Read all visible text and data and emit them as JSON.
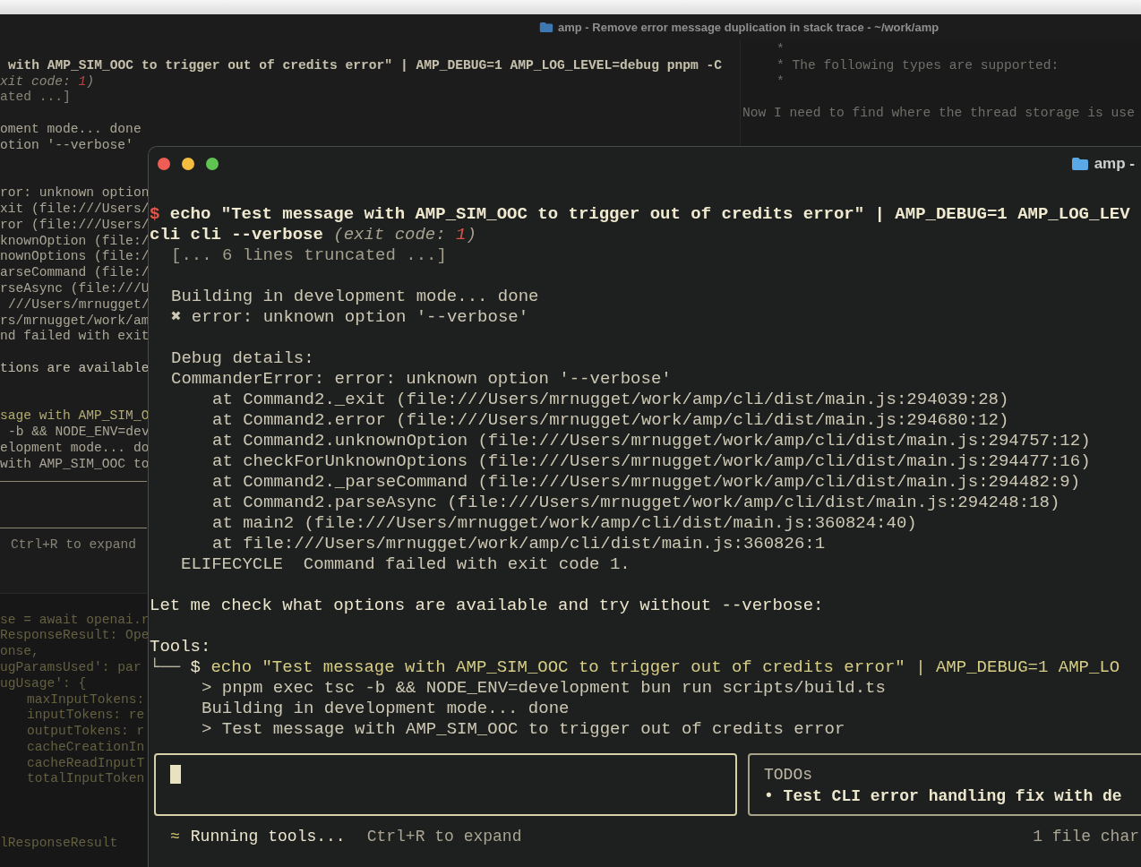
{
  "background_window": {
    "title": "amp - Remove error message duplication in stack trace - ~/work/amp",
    "left_lines": [
      {
        "kind": "blank"
      },
      {
        "kind": "shifted",
        "segments": [
          {
            "text": "with AMP_SIM_OOC to trigger out of credits error\" | AMP_DEBUG=1 AMP_LOG_LEVEL=debug pnpm -C",
            "kind": "command"
          }
        ]
      },
      {
        "kind": "plain",
        "segments": [
          {
            "text": "xit code: ",
            "kind": "italic"
          },
          {
            "text": "1",
            "kind": "error_code"
          },
          {
            "text": ")",
            "kind": "italic"
          }
        ]
      },
      {
        "kind": "plain",
        "segments": [
          {
            "text": "ated ...]",
            "kind": "dim"
          }
        ]
      },
      {
        "kind": "blank"
      },
      {
        "kind": "plain",
        "segments": [
          {
            "text": "oment mode... done",
            "kind": "output"
          }
        ]
      },
      {
        "kind": "plain",
        "segments": [
          {
            "text": "otion '--verbose'",
            "kind": "output"
          }
        ]
      },
      {
        "kind": "blank"
      },
      {
        "kind": "blank"
      },
      {
        "kind": "plain",
        "segments": [
          {
            "text": "ror: unknown option",
            "kind": "output"
          }
        ]
      },
      {
        "kind": "plain",
        "segments": [
          {
            "text": "xit (file:///Users/",
            "kind": "output"
          }
        ]
      },
      {
        "kind": "plain",
        "segments": [
          {
            "text": "ror (file:///Users/",
            "kind": "output"
          }
        ]
      },
      {
        "kind": "plain",
        "segments": [
          {
            "text": "knownOption (file:/",
            "kind": "output"
          }
        ]
      },
      {
        "kind": "plain",
        "segments": [
          {
            "text": "nownOptions (file:/",
            "kind": "output"
          }
        ]
      },
      {
        "kind": "plain",
        "segments": [
          {
            "text": "arseCommand (file:/",
            "kind": "output"
          }
        ]
      },
      {
        "kind": "plain",
        "segments": [
          {
            "text": "rseAsync (file:///U",
            "kind": "output"
          }
        ]
      },
      {
        "kind": "shifted",
        "segments": [
          {
            "text": "///Users/mrnugget/",
            "kind": "output"
          }
        ]
      },
      {
        "kind": "plain",
        "segments": [
          {
            "text": "rs/mrnugget/work/am",
            "kind": "output"
          }
        ]
      },
      {
        "kind": "plain",
        "segments": [
          {
            "text": "nd failed with exit",
            "kind": "output"
          }
        ]
      },
      {
        "kind": "blank"
      },
      {
        "kind": "plain",
        "segments": [
          {
            "text": "tions are available",
            "kind": "message"
          }
        ]
      },
      {
        "kind": "blank"
      },
      {
        "kind": "blank"
      },
      {
        "kind": "plain",
        "segments": [
          {
            "text": "sage with AMP_SIM_O",
            "kind": "tool"
          }
        ]
      },
      {
        "kind": "shifted",
        "segments": [
          {
            "text": "-b && NODE_ENV=dev",
            "kind": "output"
          }
        ]
      },
      {
        "kind": "plain",
        "segments": [
          {
            "text": "elopment mode... do",
            "kind": "output"
          }
        ]
      },
      {
        "kind": "plain",
        "segments": [
          {
            "text": "with AMP_SIM_OOC to",
            "kind": "output"
          }
        ]
      }
    ],
    "status_hint": "Ctrl+R to expand",
    "lower_lines": [
      {
        "kind": "plain",
        "segments": [
          {
            "text": "se = await openai.r",
            "kind": "olive"
          }
        ]
      },
      {
        "kind": "plain",
        "segments": [
          {
            "text": "ResponseResult: Ope",
            "kind": "olive"
          }
        ]
      },
      {
        "kind": "plain",
        "segments": [
          {
            "text": "onse,",
            "kind": "olive"
          }
        ]
      },
      {
        "kind": "plain",
        "segments": [
          {
            "text": "ugParamsUsed': par",
            "kind": "olive"
          }
        ]
      },
      {
        "kind": "plain",
        "segments": [
          {
            "text": "ugUsage': {",
            "kind": "olive"
          }
        ]
      },
      {
        "kind": "nested",
        "segments": [
          {
            "text": "maxInputTokens:",
            "kind": "olive"
          }
        ]
      },
      {
        "kind": "nested",
        "segments": [
          {
            "text": "inputTokens: re",
            "kind": "olive"
          }
        ]
      },
      {
        "kind": "nested",
        "segments": [
          {
            "text": "outputTokens: r",
            "kind": "olive"
          }
        ]
      },
      {
        "kind": "nested",
        "segments": [
          {
            "text": "cacheCreationIn",
            "kind": "olive"
          }
        ]
      },
      {
        "kind": "nested",
        "segments": [
          {
            "text": "cacheReadInputT",
            "kind": "olive"
          }
        ]
      },
      {
        "kind": "nested",
        "segments": [
          {
            "text": "totalInputToken",
            "kind": "olive"
          }
        ]
      },
      {
        "kind": "blank"
      },
      {
        "kind": "blank"
      },
      {
        "kind": "blank"
      },
      {
        "kind": "plain",
        "segments": [
          {
            "text": "lResponseResult",
            "kind": "olive"
          }
        ]
      }
    ],
    "right_lines": [
      {
        "kind": "comment",
        "segments": [
          {
            "text": "*",
            "kind": "faint"
          }
        ]
      },
      {
        "kind": "comment",
        "segments": [
          {
            "text": "* The following types are supported:",
            "kind": "faint"
          }
        ]
      },
      {
        "kind": "comment",
        "segments": [
          {
            "text": "*",
            "kind": "faint"
          }
        ]
      },
      {
        "kind": "blank"
      },
      {
        "kind": "note",
        "segments": [
          {
            "text": "Now I need to find where the thread storage is use",
            "kind": "faint"
          }
        ]
      }
    ]
  },
  "front_window": {
    "title": "amp -",
    "lines": [
      {
        "kind": "command",
        "segments": [
          {
            "text": "$",
            "kind": "prompt"
          },
          {
            "text": " echo \"Test message with AMP_SIM_OOC to trigger out of credits error\" | AMP_DEBUG=1 AMP_LOG_LEV",
            "kind": "command"
          }
        ]
      },
      {
        "kind": "command",
        "segments": [
          {
            "text": "cli cli --verbose ",
            "kind": "command"
          },
          {
            "text": "(exit code: ",
            "kind": "italic"
          },
          {
            "text": "1",
            "kind": "error_code"
          },
          {
            "text": ")",
            "kind": "italic"
          }
        ]
      },
      {
        "kind": "output",
        "segments": [
          {
            "text": "[... 6 lines truncated ...]",
            "kind": "dim"
          }
        ]
      },
      {
        "kind": "blank"
      },
      {
        "kind": "output",
        "segments": [
          {
            "text": "Building in development mode... done",
            "kind": "output"
          }
        ]
      },
      {
        "kind": "output",
        "segments": [
          {
            "text": "✖ error: unknown option '--verbose'",
            "kind": "output"
          }
        ]
      },
      {
        "kind": "blank"
      },
      {
        "kind": "output",
        "segments": [
          {
            "text": "Debug details:",
            "kind": "output"
          }
        ]
      },
      {
        "kind": "output",
        "segments": [
          {
            "text": "CommanderError: error: unknown option '--verbose'",
            "kind": "output"
          }
        ]
      },
      {
        "kind": "trace",
        "segments": [
          {
            "text": "at Command2._exit (file:///Users/mrnugget/work/amp/cli/dist/main.js:294039:28)",
            "kind": "output"
          }
        ]
      },
      {
        "kind": "trace",
        "segments": [
          {
            "text": "at Command2.error (file:///Users/mrnugget/work/amp/cli/dist/main.js:294680:12)",
            "kind": "output"
          }
        ]
      },
      {
        "kind": "trace",
        "segments": [
          {
            "text": "at Command2.unknownOption (file:///Users/mrnugget/work/amp/cli/dist/main.js:294757:12)",
            "kind": "output"
          }
        ]
      },
      {
        "kind": "trace",
        "segments": [
          {
            "text": "at checkForUnknownOptions (file:///Users/mrnugget/work/amp/cli/dist/main.js:294477:16)",
            "kind": "output"
          }
        ]
      },
      {
        "kind": "trace",
        "segments": [
          {
            "text": "at Command2._parseCommand (file:///Users/mrnugget/work/amp/cli/dist/main.js:294482:9)",
            "kind": "output"
          }
        ]
      },
      {
        "kind": "trace",
        "segments": [
          {
            "text": "at Command2.parseAsync (file:///Users/mrnugget/work/amp/cli/dist/main.js:294248:18)",
            "kind": "output"
          }
        ]
      },
      {
        "kind": "trace",
        "segments": [
          {
            "text": "at main2 (file:///Users/mrnugget/work/amp/cli/dist/main.js:360824:40)",
            "kind": "output"
          }
        ]
      },
      {
        "kind": "trace",
        "segments": [
          {
            "text": "at file:///Users/mrnugget/work/amp/cli/dist/main.js:360826:1",
            "kind": "output"
          }
        ]
      },
      {
        "kind": "footer",
        "segments": [
          {
            "text": "ELIFECYCLE  Command failed with exit code 1.",
            "kind": "output"
          }
        ]
      },
      {
        "kind": "blank"
      },
      {
        "kind": "message",
        "segments": [
          {
            "text": "Let me check what options are available and try without --verbose:",
            "kind": "message"
          }
        ]
      },
      {
        "kind": "blank"
      },
      {
        "kind": "message",
        "segments": [
          {
            "text": "Tools:",
            "kind": "message"
          }
        ]
      },
      {
        "kind": "message",
        "segments": [
          {
            "text": "└──",
            "kind": "tree"
          },
          {
            "text": " $ ",
            "kind": "message"
          },
          {
            "text": "echo \"Test message with AMP_SIM_OOC to trigger out of credits error\" | AMP_DEBUG=1 AMP_LO",
            "kind": "tool"
          }
        ]
      },
      {
        "kind": "tool_output",
        "segments": [
          {
            "text": "> pnpm exec tsc -b && NODE_ENV=development bun run scripts/build.ts",
            "kind": "output"
          }
        ]
      },
      {
        "kind": "tool_output",
        "segments": [
          {
            "text": "Building in development mode... done",
            "kind": "output"
          }
        ]
      },
      {
        "kind": "tool_output",
        "segments": [
          {
            "text": "> Test message with AMP_SIM_OOC to trigger out of credits error",
            "kind": "output"
          }
        ]
      }
    ],
    "todos": {
      "heading": "TODOs",
      "items": [
        {
          "bullet": "•",
          "text": "Test CLI error handling fix with de"
        }
      ]
    },
    "status": {
      "indicator": "≈",
      "text": "Running tools...",
      "hint": "Ctrl+R to expand",
      "changes": "1 file char"
    }
  }
}
